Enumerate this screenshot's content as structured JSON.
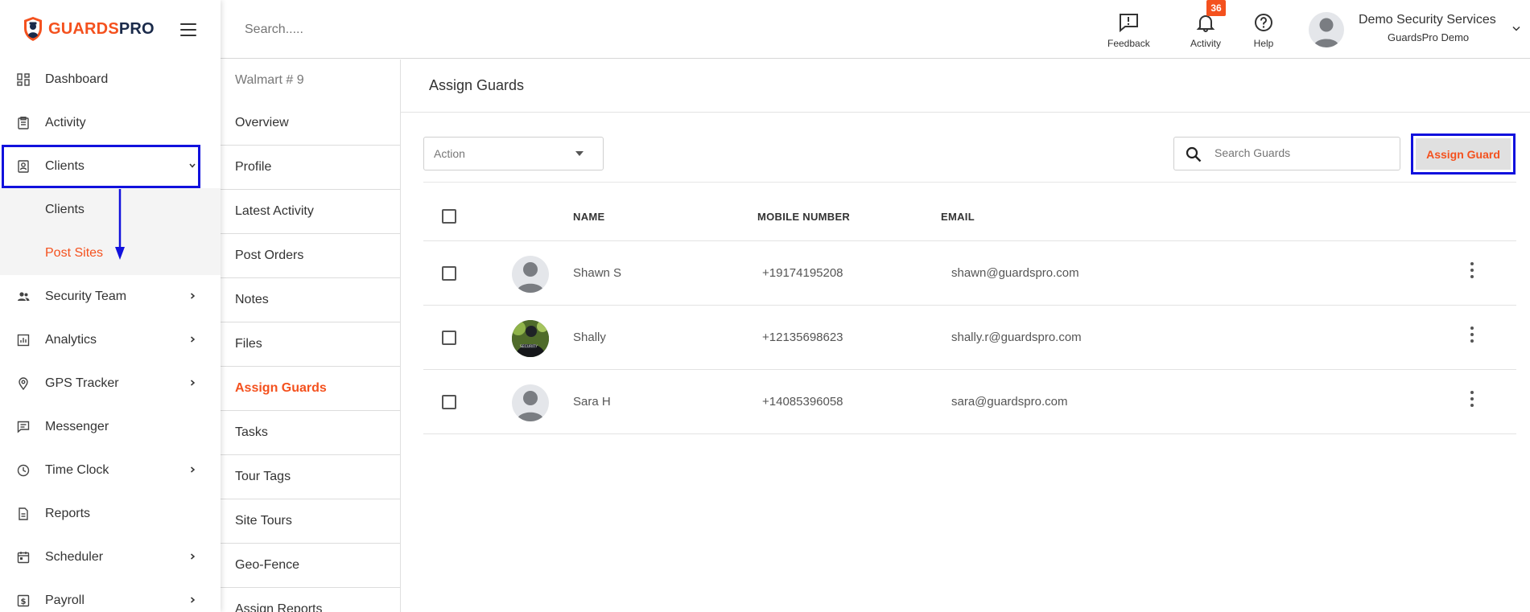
{
  "app": {
    "logo_part1": "GUARDS",
    "logo_part2": "PRO"
  },
  "sidebar": {
    "items": [
      {
        "label": "Dashboard",
        "icon": "dashboard-icon",
        "chevron": false
      },
      {
        "label": "Activity",
        "icon": "clipboard-icon",
        "chevron": false
      },
      {
        "label": "Clients",
        "icon": "clients-icon",
        "chevron": "down",
        "active": true
      },
      {
        "label": "Security Team",
        "icon": "team-icon",
        "chevron": "right"
      },
      {
        "label": "Analytics",
        "icon": "analytics-icon",
        "chevron": "right"
      },
      {
        "label": "GPS Tracker",
        "icon": "location-pin-icon",
        "chevron": "right"
      },
      {
        "label": "Messenger",
        "icon": "chat-icon",
        "chevron": false
      },
      {
        "label": "Time Clock",
        "icon": "clock-icon",
        "chevron": "right"
      },
      {
        "label": "Reports",
        "icon": "report-icon",
        "chevron": false
      },
      {
        "label": "Scheduler",
        "icon": "calendar-icon",
        "chevron": "right"
      },
      {
        "label": "Payroll",
        "icon": "payroll-icon",
        "chevron": "right"
      }
    ],
    "clients_submenu": [
      {
        "label": "Clients"
      },
      {
        "label": "Post Sites",
        "current": true
      }
    ]
  },
  "topbar": {
    "search_placeholder": "Search.....",
    "feedback_label": "Feedback",
    "activity_label": "Activity",
    "activity_badge": "36",
    "help_label": "Help",
    "user_name": "Demo Security Services",
    "user_org": "GuardsPro Demo"
  },
  "subnav": {
    "title": "Walmart # 9",
    "items": [
      {
        "label": "Overview"
      },
      {
        "label": "Profile"
      },
      {
        "label": "Latest Activity"
      },
      {
        "label": "Post Orders"
      },
      {
        "label": "Notes"
      },
      {
        "label": "Files"
      },
      {
        "label": "Assign Guards",
        "current": true
      },
      {
        "label": "Tasks"
      },
      {
        "label": "Tour Tags"
      },
      {
        "label": "Site Tours"
      },
      {
        "label": "Geo-Fence"
      },
      {
        "label": "Assign Reports"
      }
    ]
  },
  "main": {
    "title": "Assign Guards",
    "action_label": "Action",
    "search_placeholder": "Search Guards",
    "assign_button": "Assign Guard",
    "columns": {
      "name": "NAME",
      "mobile": "MOBILE NUMBER",
      "email": "EMAIL"
    },
    "rows": [
      {
        "name": "Shawn S",
        "mobile": "+19174195208",
        "email": "shawn@guardspro.com",
        "avatar": "default"
      },
      {
        "name": "Shally",
        "mobile": "+12135698623",
        "email": "shally.r@guardspro.com",
        "avatar": "photo"
      },
      {
        "name": "Sara H",
        "mobile": "+14085396058",
        "email": "sara@guardspro.com",
        "avatar": "default"
      }
    ]
  },
  "colors": {
    "accent": "#f4511e",
    "highlight": "#1111dd",
    "navy": "#1a2a4a"
  }
}
